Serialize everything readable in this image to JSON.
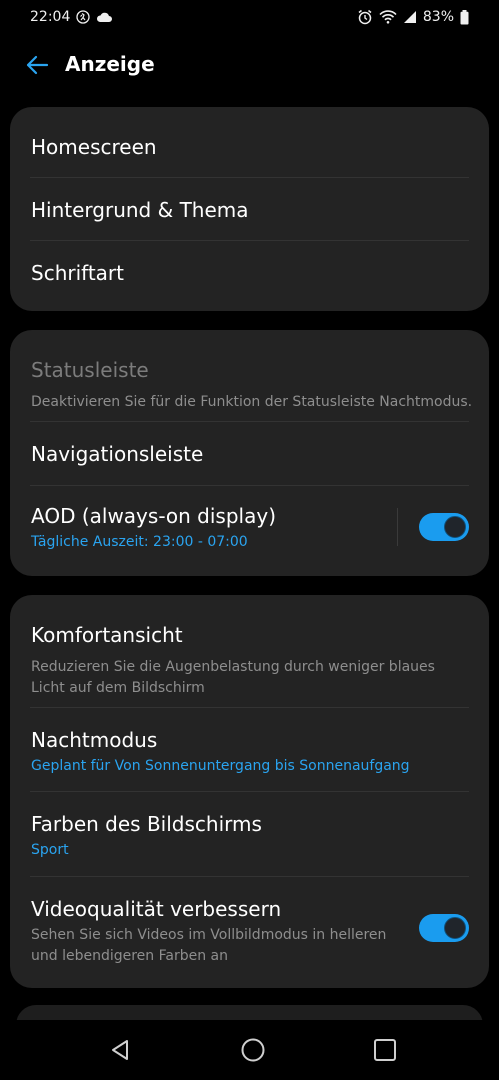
{
  "status_bar": {
    "time": "22:04",
    "battery_percent": "83%",
    "icons_left": [
      "step-counter-icon",
      "cloud-icon"
    ],
    "icons_right": [
      "alarm-icon",
      "wifi-icon",
      "signal-icon",
      "battery-icon"
    ]
  },
  "header": {
    "title": "Anzeige"
  },
  "section1": {
    "items": [
      {
        "label": "Homescreen"
      },
      {
        "label": "Hintergrund & Thema"
      },
      {
        "label": "Schriftart"
      }
    ]
  },
  "section2": {
    "statusleiste": {
      "label": "Statusleiste",
      "subtitle": "Deaktivieren Sie für die Funktion der Statusleiste Nachtmodus."
    },
    "navigationsleiste": {
      "label": "Navigationsleiste"
    },
    "aod": {
      "label": "AOD (always-on display)",
      "subtitle": "Tägliche Auszeit: 23:00 - 07:00",
      "enabled": true
    }
  },
  "section3": {
    "komfortansicht": {
      "label": "Komfortansicht",
      "subtitle": "Reduzieren Sie die Augenbelastung durch weniger blaues Licht auf dem Bildschirm"
    },
    "nachtmodus": {
      "label": "Nachtmodus",
      "subtitle": "Geplant für Von Sonnenuntergang bis Sonnenaufgang"
    },
    "farben": {
      "label": "Farben des Bildschirms",
      "subtitle": "Sport"
    },
    "video": {
      "label": "Videoqualität verbessern",
      "subtitle": "Sehen Sie sich Videos im Vollbildmodus in helleren und lebendigeren Farben an",
      "enabled": true
    }
  },
  "colors": {
    "accent": "#1a9cef",
    "card_bg": "#232323",
    "background": "#000000"
  }
}
